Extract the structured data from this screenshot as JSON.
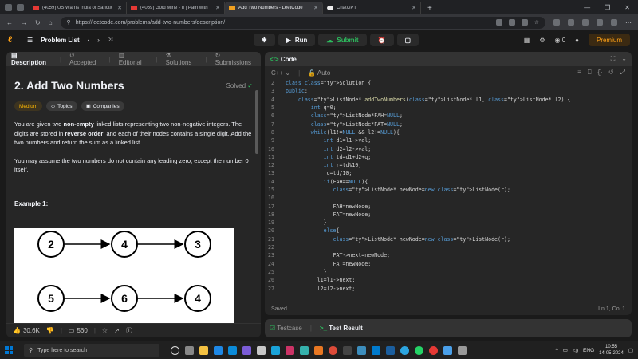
{
  "browser": {
    "tabs": [
      {
        "label": "(4059) US Warns India of Sanctio",
        "active": false,
        "kind": "yt"
      },
      {
        "label": "(4059) Gold Mine - II | Path with",
        "active": false,
        "kind": "yt"
      },
      {
        "label": "Add Two Numbers - LeetCode",
        "active": true,
        "kind": "lc"
      },
      {
        "label": "ChatGPT",
        "active": false,
        "kind": "gpt"
      }
    ],
    "new_tab": "+",
    "url": "https://leetcode.com/problems/add-two-numbers/description/"
  },
  "lc_nav": {
    "problem_list": "Problem List",
    "run": "Run",
    "submit": "Submit",
    "streak": "0",
    "premium": "Premium"
  },
  "left_tabs": [
    "Description",
    "Accepted",
    "Editorial",
    "Solutions",
    "Submissions"
  ],
  "problem": {
    "title": "2. Add Two Numbers",
    "solved": "Solved",
    "difficulty": "Medium",
    "topics": "Topics",
    "companies": "Companies",
    "para1_a": "You are given two ",
    "para1_b": "non-empty",
    "para1_c": " linked lists representing two non-negative integers. The digits are stored in ",
    "para1_d": "reverse order",
    "para1_e": ", and each of their nodes contains a single digit. Add the two numbers and return the sum as a linked list.",
    "para2": "You may assume the two numbers do not contain any leading zero, except the number 0 itself.",
    "example_label": "Example 1:",
    "list1": [
      "2",
      "4",
      "3"
    ],
    "list2": [
      "5",
      "6",
      "4"
    ]
  },
  "actions": {
    "likes": "30.6K",
    "comments": "560"
  },
  "editor": {
    "title": "Code",
    "language": "C++",
    "mode": "Auto",
    "status_left": "Saved",
    "status_right": "Ln 1, Col 1",
    "lines": [
      {
        "n": "2",
        "t": "class Solution {"
      },
      {
        "n": "3",
        "t": "public:"
      },
      {
        "n": "4",
        "t": "    ListNode* addTwoNumbers(ListNode* l1, ListNode* l2) {"
      },
      {
        "n": "5",
        "t": "        int q=0;"
      },
      {
        "n": "6",
        "t": "        ListNode*FAH=NULL;"
      },
      {
        "n": "7",
        "t": "        ListNode*FAT=NULL;"
      },
      {
        "n": "8",
        "t": "        while(l1!=NULL && l2!=NULL){"
      },
      {
        "n": "9",
        "t": "            int d1=l1->val;"
      },
      {
        "n": "10",
        "t": "            int d2=l2->val;"
      },
      {
        "n": "11",
        "t": "            int td=d1+d2+q;"
      },
      {
        "n": "12",
        "t": "            int r=td%10;"
      },
      {
        "n": "13",
        "t": "             q=td/10;"
      },
      {
        "n": "14",
        "t": "            if(FAH==NULL){"
      },
      {
        "n": "15",
        "t": "               ListNode* newNode=new ListNode(r);"
      },
      {
        "n": "16",
        "t": ""
      },
      {
        "n": "17",
        "t": "               FAH=newNode;"
      },
      {
        "n": "18",
        "t": "               FAT=newNode;"
      },
      {
        "n": "19",
        "t": "            }"
      },
      {
        "n": "20",
        "t": "            else{"
      },
      {
        "n": "21",
        "t": "               ListNode* newNode=new ListNode(r);"
      },
      {
        "n": "22",
        "t": ""
      },
      {
        "n": "23",
        "t": "               FAT->next=newNode;"
      },
      {
        "n": "24",
        "t": "               FAT=newNode;"
      },
      {
        "n": "25",
        "t": "            }"
      },
      {
        "n": "26",
        "t": "          l1=l1->next;"
      },
      {
        "n": "27",
        "t": "          l2=l2->next;"
      }
    ]
  },
  "bottom_tabs": {
    "testcase": "Testcase",
    "test_result": "Test Result"
  },
  "taskbar": {
    "search_placeholder": "Type here to search",
    "lang": "ENG",
    "time": "10:55",
    "date": "14-05-2024"
  }
}
